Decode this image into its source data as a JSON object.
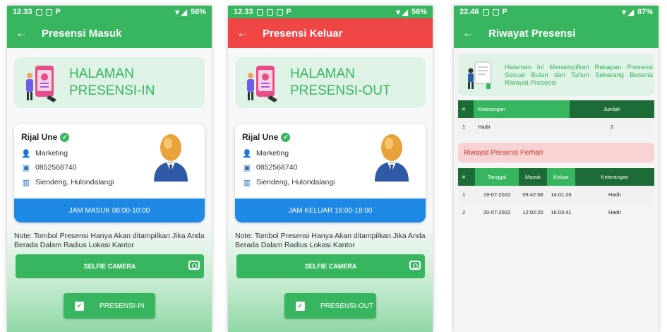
{
  "screens": [
    {
      "status": {
        "time": "12.33",
        "battery": "56%"
      },
      "header": {
        "title": "Presensi Masuk"
      },
      "banner": {
        "line1": "HALAMAN",
        "line2": "PRESENSI-IN"
      },
      "profile": {
        "name": "Rijal Une",
        "department": "Marketing",
        "phone": "0852568740",
        "address": "Siendeng, Hulondalangi"
      },
      "jam": "JAM MASUK 08:00-10:00",
      "note": "Note: Tombol Presensi Hanya Akan ditampilkan Jika Anda Berada Dalam Radius Lokasi Kantor",
      "selfie_label": "SELFIE CAMERA",
      "action_label": "PRESENSI-IN"
    },
    {
      "status": {
        "time": "12.33",
        "battery": "56%"
      },
      "header": {
        "title": "Presensi Keluar"
      },
      "banner": {
        "line1": "HALAMAN",
        "line2": "PRESENSI-OUT"
      },
      "profile": {
        "name": "Rijal Une",
        "department": "Marketing",
        "phone": "0852568740",
        "address": "Siendeng, Hulondalangi"
      },
      "jam": "JAM KELUAR 16:00-18:00",
      "note": "Note: Tombol Presensi Hanya Akan ditampilkan Jika Anda Berada Dalam Radius Lokasi Kantor",
      "selfie_label": "SELFIE CAMERA",
      "action_label": "PRESENSI-OUT"
    }
  ],
  "riwayat": {
    "status": {
      "time": "22.46",
      "battery": "87%"
    },
    "header": {
      "title": "Riwayat Presensi"
    },
    "banner_text": "Halaman Ini Menampilkan Rekapan Presensi Sesuai Bulan dan Tahun Sekarang Beserta Riwayat Presensi",
    "summary_headers": [
      "#",
      "Keterangan",
      "Jumlah"
    ],
    "summary_rows": [
      [
        "1",
        "Hadir",
        "2"
      ]
    ],
    "perhari_title": "Riwayat Presensi Perhari",
    "daily_headers": [
      "#",
      "Tanggal",
      "Masuk",
      "Keluar",
      "Keterangan"
    ],
    "daily_rows": [
      [
        "1",
        "19-07-2022",
        "09:42:58",
        "14:01:26",
        "Hadir"
      ],
      [
        "2",
        "20-07-2022",
        "12:02:20",
        "16:03:41",
        "Hadir"
      ]
    ]
  },
  "colors": {
    "primary": "#37b65f",
    "dark": "#1d6b37",
    "danger": "#f04646",
    "info": "#1e88e5",
    "banner_bg": "#dff2e6"
  }
}
